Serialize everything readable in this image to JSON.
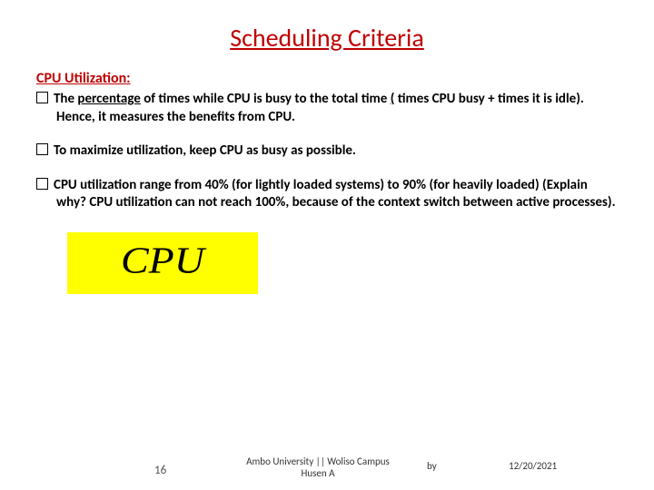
{
  "title": "Scheduling Criteria",
  "subhead": "CPU Utilization:",
  "points": [
    {
      "lead": "The ",
      "u1": "percentage",
      "mid1": " of times while CPU is busy to the total time ",
      "u2": "(",
      "mid2": " times CPU busy + times it is idle). Hence, it measures the benefits from CPU."
    },
    {
      "text_pre": "To maximize utilization, ",
      "text_bold": "keep CPU as busy as possible."
    },
    {
      "textA": "CPU utilization range from 40% (for lightly loaded systems) to 90% (for heavily loaded) ",
      "u3": "(",
      "textB": "Explain why? CPU utilization can not reach 100%, because of the context switch between active processes)."
    }
  ],
  "cpu_label": "CPU",
  "footer": {
    "page": "16",
    "credit_line1": "Ambo University || Woliso Campus",
    "credit_line2": "Husen A",
    "by": "by",
    "date": "12/20/2021"
  }
}
